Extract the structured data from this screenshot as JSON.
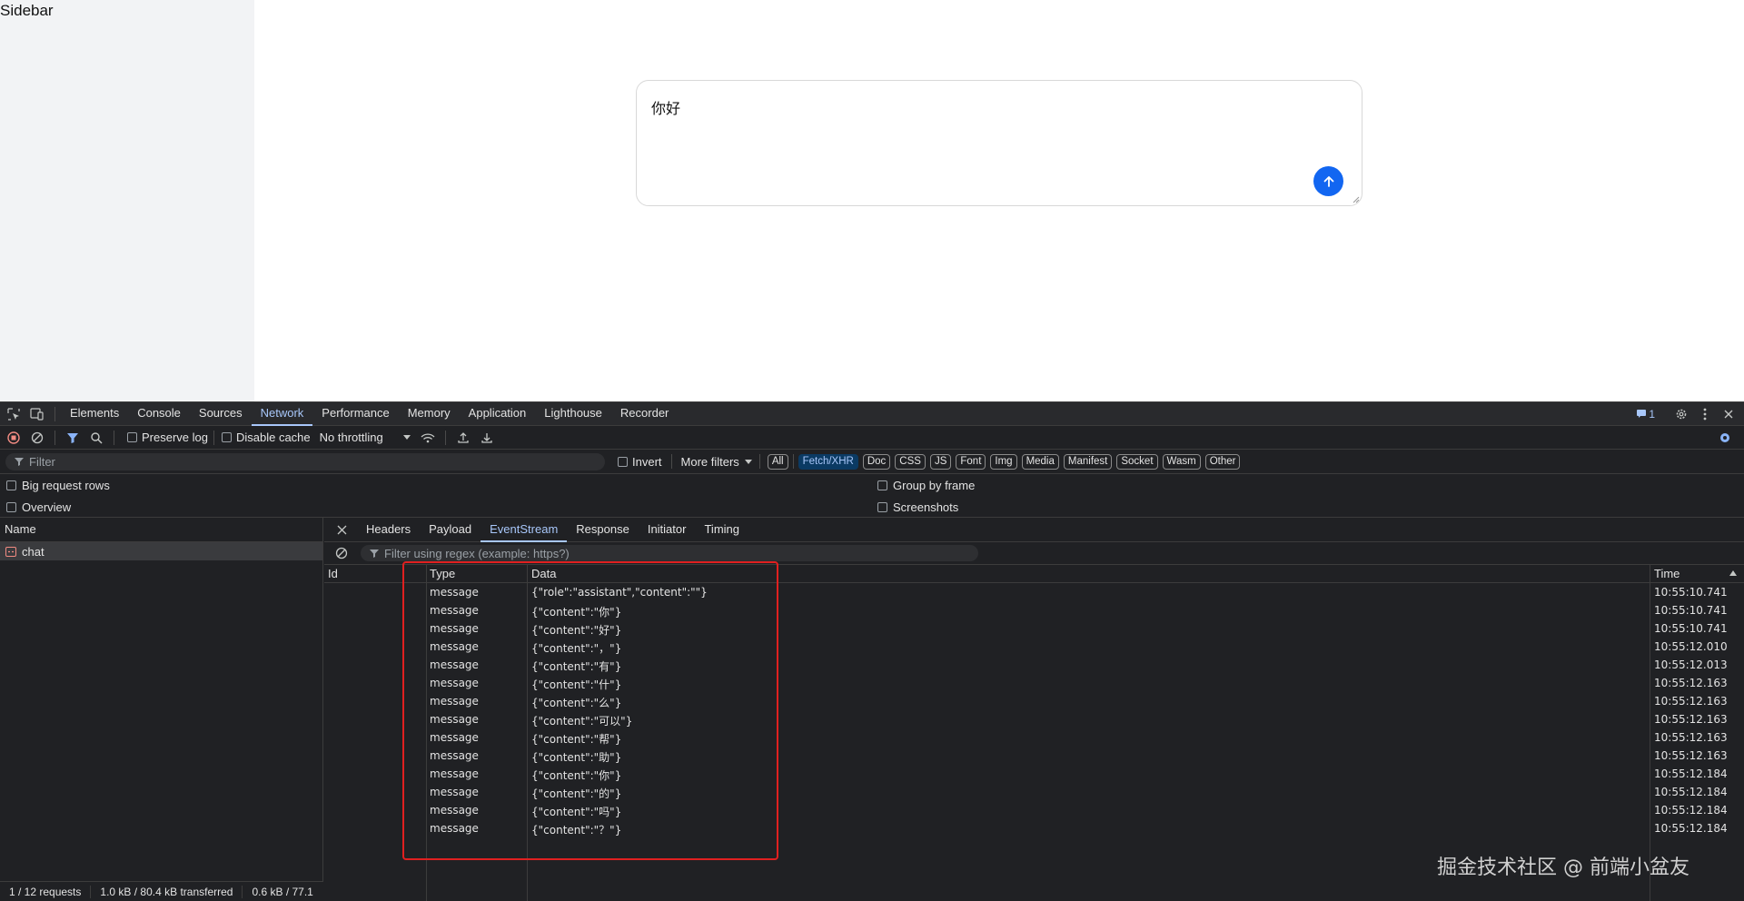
{
  "app": {
    "sidebar_label": "Sidebar",
    "input_text": "你好",
    "accent_color": "#1266f1"
  },
  "devtools": {
    "panel_tabs": [
      "Elements",
      "Console",
      "Sources",
      "Network",
      "Performance",
      "Memory",
      "Application",
      "Lighthouse",
      "Recorder"
    ],
    "active_panel": "Network",
    "issues_count": "1",
    "toolbar": {
      "preserve_log": "Preserve log",
      "disable_cache": "Disable cache",
      "throttling": "No throttling"
    },
    "filter": {
      "placeholder": "Filter",
      "invert": "Invert",
      "more_filters": "More filters",
      "types": [
        "All",
        "Fetch/XHR",
        "Doc",
        "CSS",
        "JS",
        "Font",
        "Img",
        "Media",
        "Manifest",
        "Socket",
        "Wasm",
        "Other"
      ],
      "active_type": "Fetch/XHR"
    },
    "options": {
      "big_request_rows": "Big request rows",
      "overview": "Overview",
      "group_by_frame": "Group by frame",
      "screenshots": "Screenshots"
    },
    "request_list": {
      "header": "Name",
      "requests": [
        "chat"
      ]
    },
    "status": {
      "requests": "1 / 12 requests",
      "transferred": "1.0 kB / 80.4 kB transferred",
      "resources": "0.6 kB / 77.1"
    },
    "detail_tabs": [
      "Headers",
      "Payload",
      "EventStream",
      "Response",
      "Initiator",
      "Timing"
    ],
    "active_detail_tab": "EventStream",
    "eventstream": {
      "filter_placeholder": "Filter using regex (example: https?)",
      "columns": [
        "Id",
        "Type",
        "Data",
        "Time"
      ],
      "rows": [
        {
          "id": "",
          "type": "message",
          "data": "{\"role\":\"assistant\",\"content\":\"\"}",
          "time": "10:55:10.741"
        },
        {
          "id": "",
          "type": "message",
          "data": "{\"content\":\"你\"}",
          "time": "10:55:10.741"
        },
        {
          "id": "",
          "type": "message",
          "data": "{\"content\":\"好\"}",
          "time": "10:55:10.741"
        },
        {
          "id": "",
          "type": "message",
          "data": "{\"content\":\"，\"}",
          "time": "10:55:12.010"
        },
        {
          "id": "",
          "type": "message",
          "data": "{\"content\":\"有\"}",
          "time": "10:55:12.013"
        },
        {
          "id": "",
          "type": "message",
          "data": "{\"content\":\"什\"}",
          "time": "10:55:12.163"
        },
        {
          "id": "",
          "type": "message",
          "data": "{\"content\":\"么\"}",
          "time": "10:55:12.163"
        },
        {
          "id": "",
          "type": "message",
          "data": "{\"content\":\"可以\"}",
          "time": "10:55:12.163"
        },
        {
          "id": "",
          "type": "message",
          "data": "{\"content\":\"帮\"}",
          "time": "10:55:12.163"
        },
        {
          "id": "",
          "type": "message",
          "data": "{\"content\":\"助\"}",
          "time": "10:55:12.163"
        },
        {
          "id": "",
          "type": "message",
          "data": "{\"content\":\"你\"}",
          "time": "10:55:12.184"
        },
        {
          "id": "",
          "type": "message",
          "data": "{\"content\":\"的\"}",
          "time": "10:55:12.184"
        },
        {
          "id": "",
          "type": "message",
          "data": "{\"content\":\"吗\"}",
          "time": "10:55:12.184"
        },
        {
          "id": "",
          "type": "message",
          "data": "{\"content\":\"？\"}",
          "time": "10:55:12.184"
        }
      ]
    }
  },
  "watermark": "掘金技术社区 @ 前端小盆友"
}
